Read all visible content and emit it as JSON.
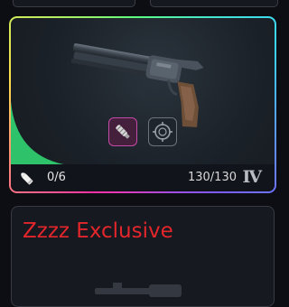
{
  "weapon_card": {
    "ammo": "0/6",
    "durability": "130/130",
    "tier": "Ⅳ",
    "rarity_color": "#2ec26a",
    "attachments": [
      {
        "icon": "suppressor-icon",
        "equipped": true,
        "accent": "#c34aa5"
      },
      {
        "icon": "scope-icon",
        "equipped": false,
        "accent": "#6d737b"
      }
    ]
  },
  "second_card": {
    "title": "Zzzz Exclusive",
    "title_color": "#e3262c"
  }
}
